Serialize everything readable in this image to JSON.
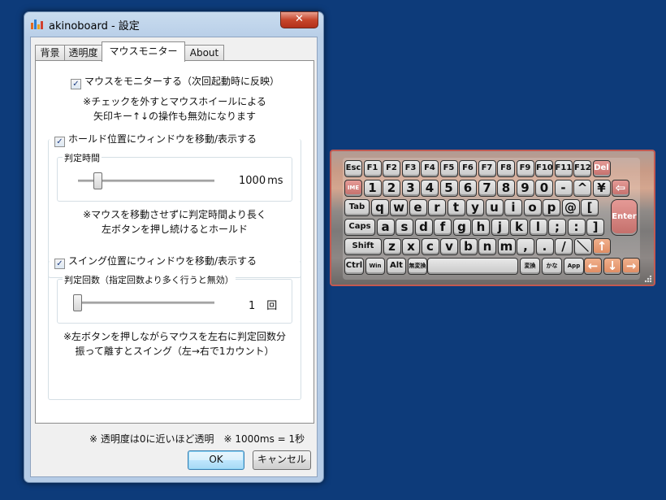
{
  "window": {
    "title": "akinoboard - 設定",
    "close_label": "✕"
  },
  "tabs": [
    "背景",
    "透明度",
    "マウスモニター",
    "About"
  ],
  "mouse_monitor": {
    "enable_label": "マウスをモニターする（次回起動時に反映）",
    "enable_checked": true,
    "note_line1": "※チェックを外すとマウスホイールによる",
    "note_line2": "矢印キー↑↓の操作も無効になります"
  },
  "hold": {
    "label": "ホールド位置にウィンドウを移動/表示する",
    "checked": true,
    "group_label": "判定時間",
    "value": "1000",
    "unit": "ms",
    "slider_fraction": 0.15,
    "note_line1": "※マウスを移動させずに判定時間より長く",
    "note_line2": "左ボタンを押し続けるとホールド"
  },
  "swing": {
    "label": "スイング位置にウィンドウを移動/表示する",
    "checked": true,
    "group_label": "判定回数（指定回数より多く行うと無効）",
    "value": "1",
    "unit": "回",
    "slider_fraction": 0.0,
    "note_line1": "※左ボタンを押しながらマウスを左右に判定回数分",
    "note_line2": "振って離すとスイング（左→右で1カウント）"
  },
  "footer_note": "※ 透明度は0に近いほど透明　※ 1000ms = 1秒",
  "buttons": {
    "ok": "OK",
    "cancel": "キャンセル"
  },
  "keyboard": {
    "row1": [
      "Esc",
      "F1",
      "F2",
      "F3",
      "F4",
      "F5",
      "F6",
      "F7",
      "F8",
      "F9",
      "F10",
      "F11",
      "F12",
      "Del"
    ],
    "row2": [
      "IME",
      "1",
      "2",
      "3",
      "4",
      "5",
      "6",
      "7",
      "8",
      "9",
      "0",
      "-",
      "^",
      "¥",
      "⇦"
    ],
    "row3": [
      "Tab",
      "q",
      "w",
      "e",
      "r",
      "t",
      "y",
      "u",
      "i",
      "o",
      "p",
      "@",
      "["
    ],
    "row4": [
      "Caps",
      "a",
      "s",
      "d",
      "f",
      "g",
      "h",
      "j",
      "k",
      "l",
      ";",
      ":",
      "]"
    ],
    "row5": [
      "Shift",
      "z",
      "x",
      "c",
      "v",
      "b",
      "n",
      "m",
      ",",
      ".",
      "/",
      "＼",
      "↑"
    ],
    "row6": [
      "Ctrl",
      "Win",
      "Alt",
      "無変換",
      "",
      "変換",
      "かな",
      "App",
      "←",
      "↓",
      "→"
    ],
    "enter": "Enter",
    "colors": {
      "red_key": "#c36e6a",
      "orange_key": "#df8a60",
      "border": "#c25a52"
    }
  }
}
